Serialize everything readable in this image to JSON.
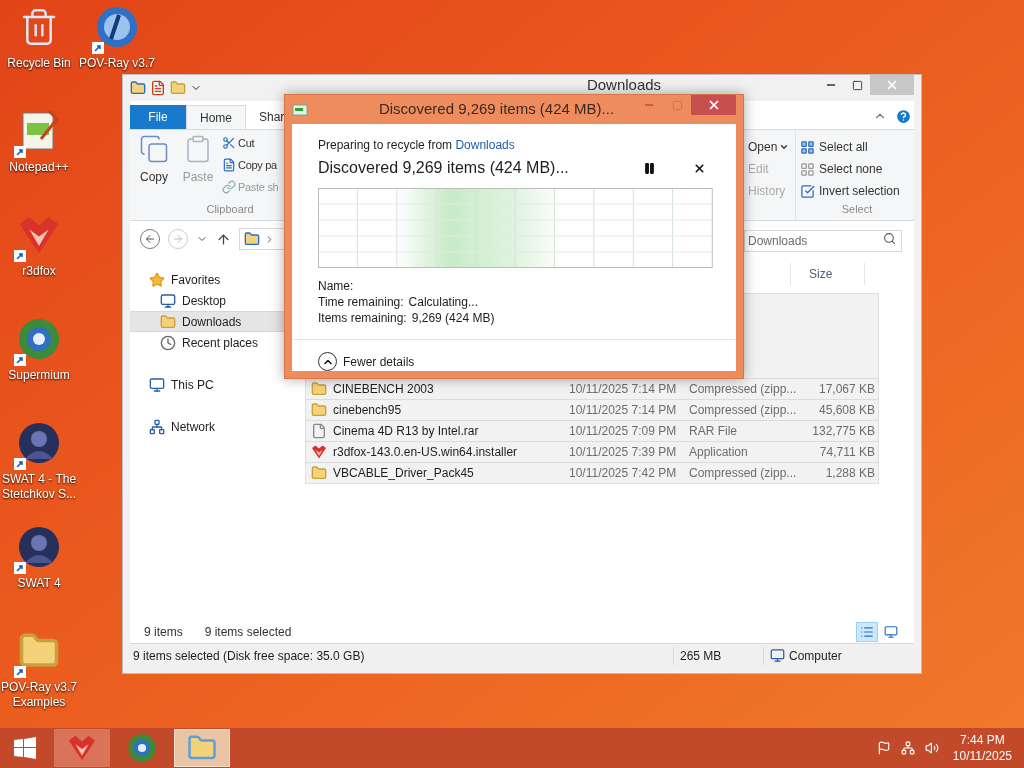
{
  "desktop_icons": [
    {
      "label": "Recycle Bin",
      "kind": "bin",
      "shortcut": false
    },
    {
      "label": "POV-Ray v3.7",
      "kind": "povray",
      "shortcut": true
    },
    {
      "label": "Notepad++",
      "kind": "notepad",
      "shortcut": true
    },
    {
      "label": "r3dfox",
      "kind": "fox",
      "shortcut": true
    },
    {
      "label": "Supermium",
      "kind": "browser",
      "shortcut": true
    },
    {
      "label": "SWAT 4 - The Stetchkov S...",
      "kind": "game",
      "shortcut": true
    },
    {
      "label": "SWAT 4",
      "kind": "game",
      "shortcut": true
    },
    {
      "label": "POV-Ray v3.7 Examples",
      "kind": "folder",
      "shortcut": true
    }
  ],
  "explorer": {
    "title": "Downloads",
    "tabs": [
      {
        "label": "File",
        "kind": "file",
        "selected": false
      },
      {
        "label": "Home",
        "kind": "tab",
        "selected": true
      },
      {
        "label": "Shar",
        "kind": "tab",
        "selected": false
      }
    ],
    "clipboard": {
      "large": [
        {
          "label": "Copy",
          "kind": "copy",
          "disabled": false
        },
        {
          "label": "Paste",
          "kind": "paste",
          "disabled": true
        }
      ],
      "small": [
        {
          "label": "Cut",
          "kind": "cut",
          "disabled": false
        },
        {
          "label": "Copy pa",
          "kind": "copypath",
          "disabled": false
        },
        {
          "label": "Paste sh",
          "kind": "shortcut",
          "disabled": true
        }
      ],
      "group": "Clipboard"
    },
    "open": [
      {
        "label": "Open",
        "dropdown": true,
        "disabled": false
      },
      {
        "label": "Edit",
        "dropdown": false,
        "disabled": true
      },
      {
        "label": "History",
        "dropdown": false,
        "disabled": true
      }
    ],
    "select": {
      "items": [
        {
          "label": "Select all",
          "kind": "all"
        },
        {
          "label": "Select none",
          "kind": "none"
        },
        {
          "label": "Invert selection",
          "kind": "invert"
        }
      ],
      "group": "Select"
    },
    "search": {
      "placeholder": "Downloads"
    },
    "nav_pane": [
      {
        "label": "Favorites",
        "kind": "star",
        "selected": false,
        "children": [
          {
            "label": "Desktop",
            "kind": "desktop",
            "selected": false
          },
          {
            "label": "Downloads",
            "kind": "downloads",
            "selected": true
          },
          {
            "label": "Recent places",
            "kind": "recent",
            "selected": false
          }
        ]
      },
      {
        "label": "This PC",
        "kind": "pc",
        "selected": false
      },
      {
        "label": "Network",
        "kind": "network",
        "selected": false
      }
    ],
    "columns": [
      {
        "label": "Size"
      }
    ],
    "files": [
      {
        "name": "CINEBENCH 2003",
        "date": "10/11/2025 7:14 PM",
        "type": "Compressed (zipp...",
        "size": "17,067 KB",
        "kind": "zip",
        "selected": true
      },
      {
        "name": "cinebench95",
        "date": "10/11/2025 7:14 PM",
        "type": "Compressed (zipp...",
        "size": "45,608 KB",
        "kind": "zip",
        "selected": true
      },
      {
        "name": "Cinema 4D R13 by Intel.rar",
        "date": "10/11/2025 7:09 PM",
        "type": "RAR File",
        "size": "132,775 KB",
        "kind": "file",
        "selected": true
      },
      {
        "name": "r3dfox-143.0.en-US.win64.installer",
        "date": "10/11/2025 7:39 PM",
        "type": "Application",
        "size": "74,711 KB",
        "kind": "fox",
        "selected": true
      },
      {
        "name": "VBCABLE_Driver_Pack45",
        "date": "10/11/2025 7:42 PM",
        "type": "Compressed (zipp...",
        "size": "1,288 KB",
        "kind": "zip",
        "selected": true
      }
    ],
    "item_count": "9 items",
    "selection_count": "9 items selected",
    "views": [
      {
        "kind": "details",
        "selected": true
      },
      {
        "kind": "tiles",
        "selected": false
      }
    ],
    "status_bar": {
      "text": "9 items selected (Disk free space: 35.0 GB)",
      "size": "265 MB",
      "location": "Computer"
    }
  },
  "dialog": {
    "title": "Discovered 9,269 items (424 MB)...",
    "prefix": "Preparing to recycle from ",
    "link": "Downloads",
    "heading": "Discovered 9,269 items (424 MB)...",
    "details": [
      {
        "label": "Name:"
      },
      {
        "label": "Time remaining:",
        "value": "Calculating..."
      },
      {
        "label": "Items remaining:",
        "value": "9,269 (424 MB)"
      }
    ],
    "toggle": "Fewer details"
  },
  "taskbar": {
    "apps": [
      {
        "kind": "fox",
        "running": true,
        "selected": false
      },
      {
        "kind": "browser",
        "running": false,
        "selected": false
      },
      {
        "kind": "explorer",
        "running": true,
        "selected": true
      }
    ],
    "time": "7:44 PM",
    "date": "10/11/2025"
  }
}
